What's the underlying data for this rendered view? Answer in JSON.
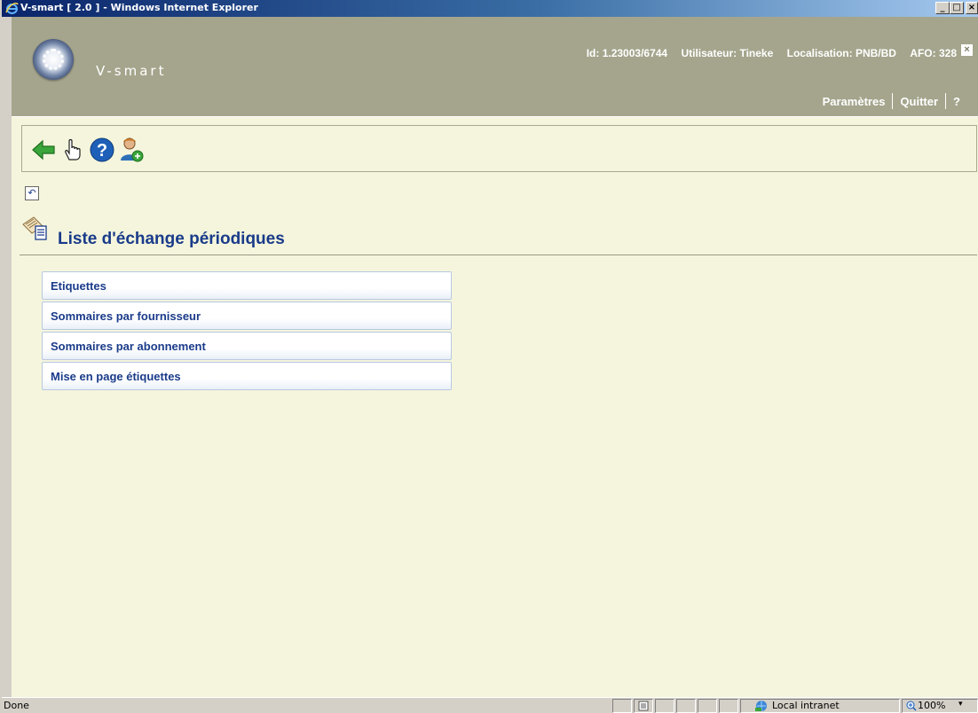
{
  "window": {
    "title": "V-smart [ 2.0 ] - Windows Internet Explorer",
    "minimize": "_",
    "maximize": "□",
    "close": "×"
  },
  "header": {
    "brand": "V-smart",
    "id": "Id: 1.23003/6744",
    "user": "Utilisateur: Tineke",
    "location": "Localisation: PNB/BD",
    "afo": "AFO: 328",
    "close_glyph": "×",
    "links": {
      "settings": "Paramètres",
      "quit": "Quitter",
      "help": "?"
    }
  },
  "toolbar": {
    "icons": [
      "back-arrow-icon",
      "pointer-hand-icon",
      "help-icon",
      "user-switch-icon"
    ]
  },
  "page": {
    "undo_glyph": "↶",
    "title": "Liste d'échange périodiques",
    "menu": [
      {
        "label": "Etiquettes"
      },
      {
        "label": "Sommaires par fournisseur"
      },
      {
        "label": "Sommaires par abonnement"
      },
      {
        "label": "Mise en page étiquettes"
      }
    ]
  },
  "statusbar": {
    "status": "Done",
    "zone": "Local intranet",
    "zoom": "100%"
  },
  "colors": {
    "header_bg": "#a5a58d",
    "content_bg": "#f4f5dc",
    "accent": "#1a3b8a"
  }
}
